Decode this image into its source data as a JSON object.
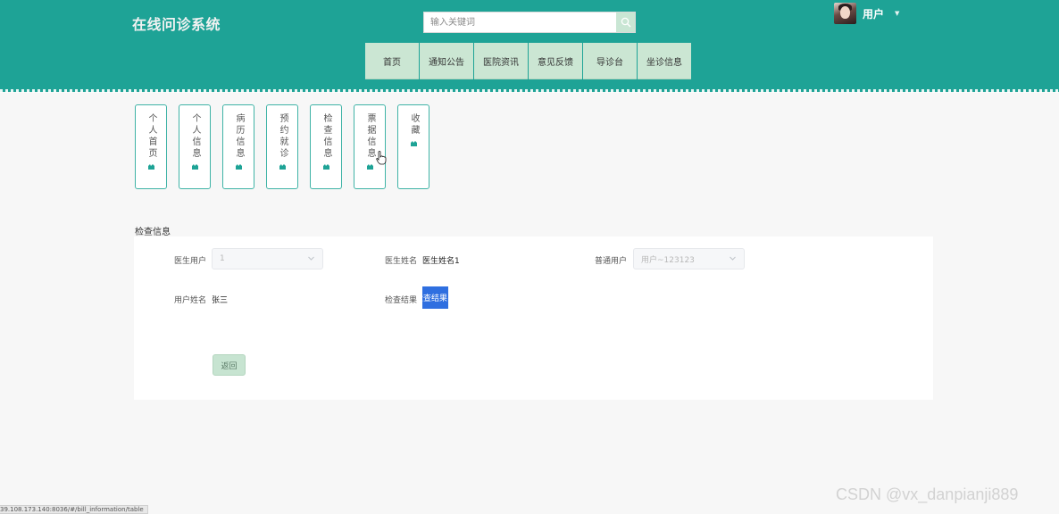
{
  "header": {
    "site_title": "在线问诊系统",
    "search": {
      "placeholder": "输入关键词",
      "value": ""
    },
    "user": {
      "name": "用户"
    }
  },
  "nav": [
    "首页",
    "通知公告",
    "医院资讯",
    "意见反馈",
    "导诊台",
    "坐诊信息"
  ],
  "side_menu": [
    "个人首页",
    "个人信息",
    "病历信息",
    "预约就诊",
    "检查信息",
    "票据信息",
    "收藏"
  ],
  "section": {
    "title": "检查信息",
    "fields": {
      "doctor_user": {
        "label": "医生用户",
        "value": "1"
      },
      "doctor_name": {
        "label": "医生姓名",
        "value": "医生姓名1"
      },
      "normal_user": {
        "label": "普通用户",
        "value": "用户~123123"
      },
      "user_name": {
        "label": "用户姓名",
        "value": "张三"
      },
      "check_result": {
        "label": "检查结果",
        "value": "检查结果"
      }
    },
    "back_label": "返回"
  },
  "status_url": "39.108.173.140:8036/#/bill_information/table",
  "watermark": "CSDN @vx_danpianji889",
  "colors": {
    "header_bg": "#1ea396",
    "nav_bg": "#cbe6d3",
    "card_border": "#3fb3a6",
    "result_bg": "#2f6fe0"
  }
}
